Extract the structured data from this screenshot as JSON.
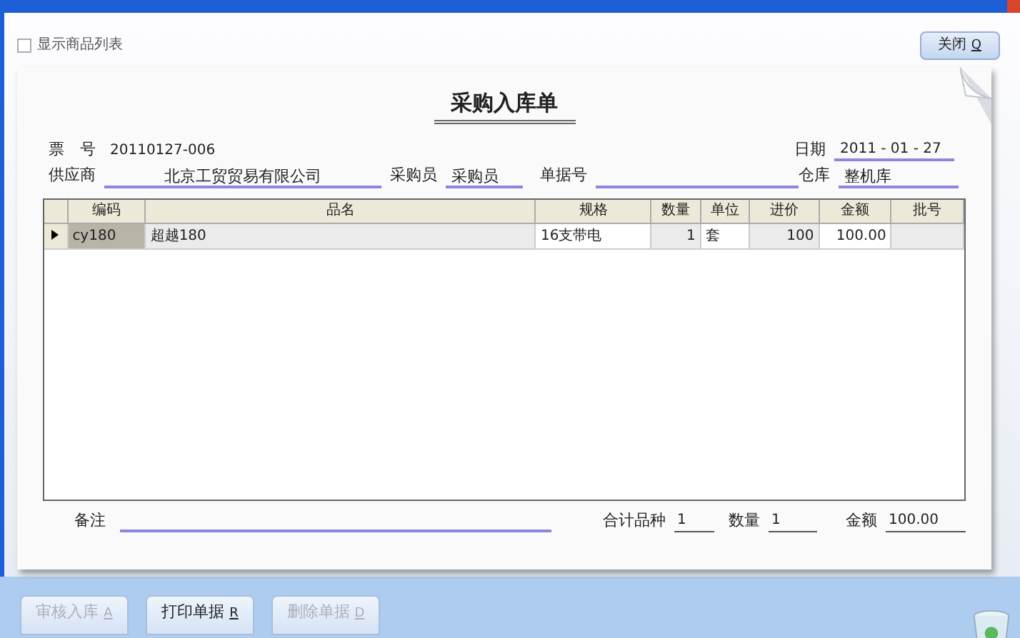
{
  "show_list": {
    "label": "显示商品列表",
    "checked": false
  },
  "close_button": {
    "label": "关闭",
    "key": "Q"
  },
  "form": {
    "title": "采购入库单",
    "ticket": {
      "label": "票　号",
      "value": "20110127-006"
    },
    "date": {
      "label": "日期",
      "value": "2011 - 01 - 27"
    },
    "supplier": {
      "label": "供应商",
      "value": "北京工贸贸易有限公司"
    },
    "buyer": {
      "label": "采购员",
      "value": "采购员"
    },
    "doc_no": {
      "label": "单据号"
    },
    "warehouse": {
      "label": "仓库",
      "value": "整机库"
    }
  },
  "table": {
    "columns": [
      "编码",
      "品名",
      "规格",
      "数量",
      "单位",
      "进价",
      "金额",
      "批号"
    ],
    "rows": [
      {
        "selected": true,
        "cells": [
          "cy180",
          "超越180",
          "16支带电",
          "1",
          "套",
          "100",
          "100.00",
          ""
        ]
      }
    ]
  },
  "footer": {
    "note": {
      "label": "备注"
    },
    "items": {
      "label": "合计品种",
      "value": "1"
    },
    "qty": {
      "label": "数量",
      "value": "1"
    },
    "amount": {
      "label": "金额",
      "value": "100.00"
    }
  },
  "buttons": [
    {
      "label": "审核入库",
      "key": "A",
      "disabled": true
    },
    {
      "label": "打印单据",
      "key": "R",
      "disabled": false
    },
    {
      "label": "删除单据",
      "key": "D",
      "disabled": true
    }
  ]
}
